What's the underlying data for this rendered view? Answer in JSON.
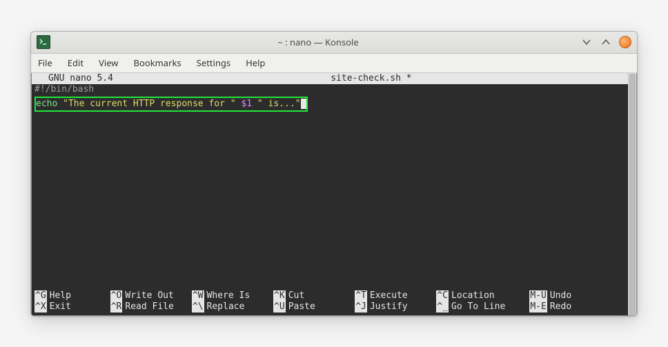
{
  "window": {
    "title": "~ : nano — Konsole"
  },
  "menubar": {
    "file": "File",
    "edit": "Edit",
    "view": "View",
    "bookmarks": "Bookmarks",
    "settings": "Settings",
    "help": "Help"
  },
  "nano": {
    "app": "GNU nano 5.4",
    "filename": "site-check.sh *"
  },
  "content": {
    "shebang": "#!/bin/bash",
    "echo_kw": "echo ",
    "str1": "\"The current HTTP response for \"",
    "var": " $1 ",
    "str2": "\" is...\""
  },
  "shortcuts": {
    "row1": [
      {
        "key": "^G",
        "label": "Help"
      },
      {
        "key": "^O",
        "label": "Write Out"
      },
      {
        "key": "^W",
        "label": "Where Is"
      },
      {
        "key": "^K",
        "label": "Cut"
      },
      {
        "key": "^T",
        "label": "Execute"
      },
      {
        "key": "^C",
        "label": "Location"
      },
      {
        "key": "M-U",
        "label": "Undo"
      }
    ],
    "row2": [
      {
        "key": "^X",
        "label": "Exit"
      },
      {
        "key": "^R",
        "label": "Read File"
      },
      {
        "key": "^\\",
        "label": "Replace"
      },
      {
        "key": "^U",
        "label": "Paste"
      },
      {
        "key": "^J",
        "label": "Justify"
      },
      {
        "key": "^_",
        "label": "Go To Line"
      },
      {
        "key": "M-E",
        "label": "Redo"
      }
    ]
  }
}
